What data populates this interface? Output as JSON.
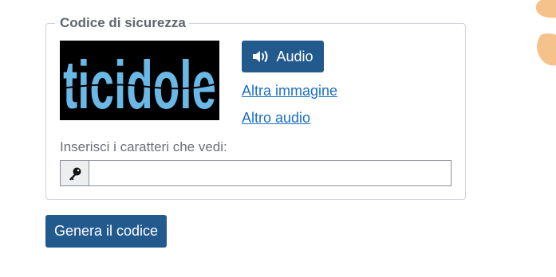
{
  "captcha": {
    "legend": "Codice di sicurezza",
    "image_text": "ticidole",
    "audio_button_label": "Audio",
    "other_image_link": "Altra immagine",
    "other_audio_link": "Altro audio",
    "input_label": "Inserisci i caratteri che vedi:",
    "input_value": "",
    "input_placeholder": ""
  },
  "actions": {
    "generate_label": "Genera il codice"
  },
  "colors": {
    "primary": "#235a8e",
    "link": "#1c6fc1",
    "captcha_text": "#6ab8e6",
    "captcha_bg": "#000000",
    "decoration": "#f6c28b"
  },
  "icons": {
    "audio": "speaker-volume-icon",
    "input_addon": "key-icon"
  }
}
